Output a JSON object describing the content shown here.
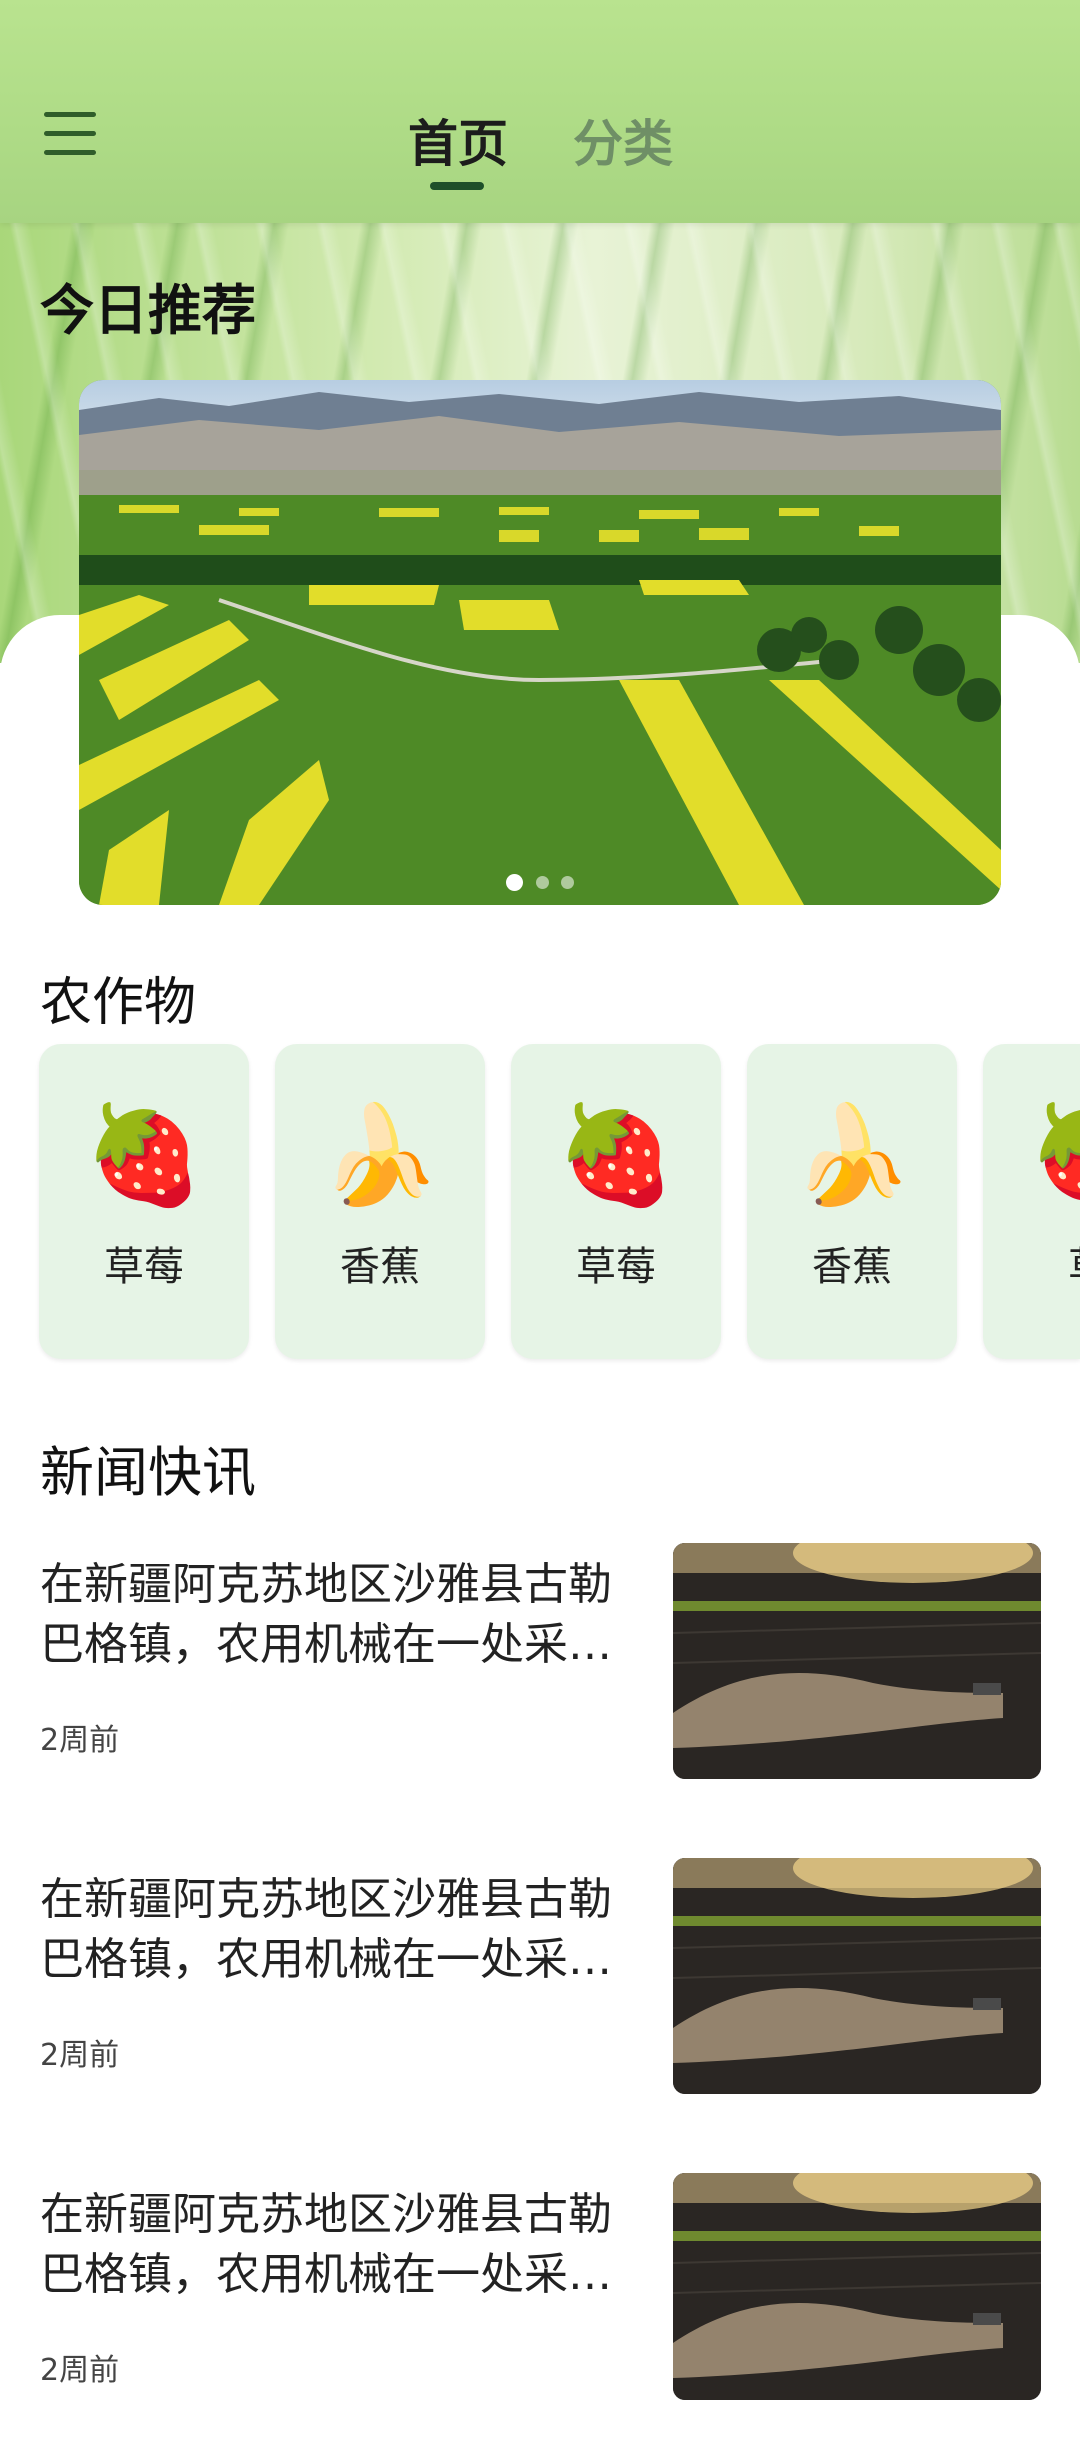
{
  "header": {
    "tabs": [
      {
        "label": "首页",
        "active": true
      },
      {
        "label": "分类",
        "active": false
      }
    ],
    "menu_icon": "menu-icon"
  },
  "recommend": {
    "title": "今日推荐",
    "banner_index": 0,
    "banner_count": 3
  },
  "crops": {
    "title": "农作物",
    "items": [
      {
        "icon": "🍓",
        "label": "草莓"
      },
      {
        "icon": "🍌",
        "label": "香蕉"
      },
      {
        "icon": "🍓",
        "label": "草莓"
      },
      {
        "icon": "🍌",
        "label": "香蕉"
      },
      {
        "icon": "🍓",
        "label": "草"
      }
    ]
  },
  "news": {
    "title": "新闻快讯",
    "items": [
      {
        "title": "在新疆阿克苏地区沙雅县古勒巴格镇，农用机械在一处采…",
        "time": "2周前"
      },
      {
        "title": "在新疆阿克苏地区沙雅县古勒巴格镇，农用机械在一处采…",
        "time": "2周前"
      },
      {
        "title": "在新疆阿克苏地区沙雅县古勒巴格镇，农用机械在一处采…",
        "time": "2周前"
      }
    ]
  },
  "colors": {
    "header": "#b3de8a",
    "accent": "#1e4f2a",
    "card": "#e6f4e6"
  }
}
